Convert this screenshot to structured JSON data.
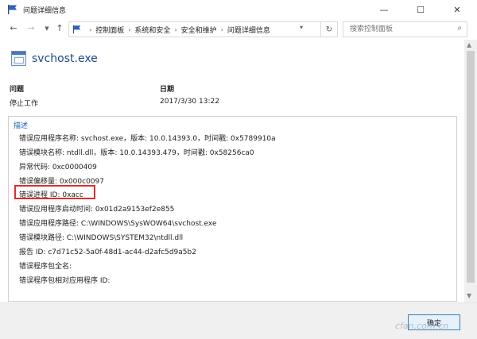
{
  "window": {
    "title": "问题详细信息"
  },
  "nav": {
    "breadcrumbs": [
      "控制面板",
      "系统和安全",
      "安全和维护",
      "问题详细信息"
    ],
    "search_placeholder": "搜索控制面板"
  },
  "app": {
    "name": "svchost.exe"
  },
  "columns": {
    "problem_label": "问题",
    "problem_value": "停止工作",
    "date_label": "日期",
    "date_value": "2017/3/30 13:22"
  },
  "description": {
    "title": "描述",
    "lines": [
      "错误应用程序名称: svchost.exe，版本: 10.0.14393.0，时间戳: 0x5789910a",
      "错误模块名称: ntdll.dll，版本: 10.0.14393.479，时间戳: 0x58256ca0",
      "异常代码: 0xc0000409",
      "错误偏移量: 0x000c0097",
      "错误进程 ID: 0xacc",
      "错误应用程序启动时间: 0x01d2a9153ef2e855",
      "错误应用程序路径: C:\\WINDOWS\\SysWOW64\\svchost.exe",
      "错误模块路径: C:\\WINDOWS\\SYSTEM32\\ntdll.dll",
      "报告 ID: c7d71c52-5a0f-48d1-ac44-d2afc5d9a5b2",
      "错误程序包全名:",
      "错误程序包相对应用程序 ID:"
    ],
    "highlighted_line_index": 4
  },
  "footer": {
    "ok_label": "确定"
  },
  "watermark": "cfan.com.cn",
  "colors": {
    "accent": "#1d5fb5",
    "highlight": "#e12c2c",
    "ok_border": "#3c7fb1"
  }
}
